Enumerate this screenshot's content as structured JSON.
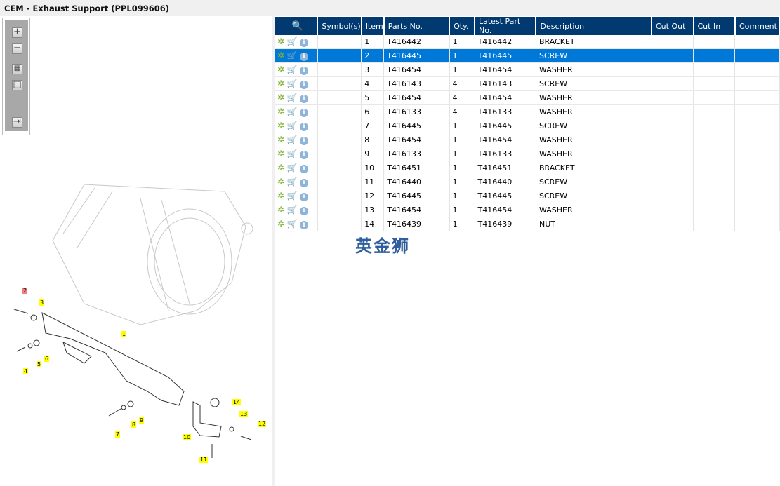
{
  "window": {
    "title": "CEM - Exhaust Support (PPL099606)"
  },
  "toolbar": {
    "zoom_in": "+",
    "zoom_out": "−",
    "fit": "▦",
    "actual": "□",
    "export": "⇥"
  },
  "table": {
    "headers": [
      "",
      "Symbol(s)",
      "Item",
      "Parts No.",
      "Qty.",
      "Latest Part No.",
      "Description",
      "Cut Out",
      "Cut In",
      "Comment"
    ],
    "selected_item": "2",
    "rows": [
      {
        "item": "1",
        "part": "T416442",
        "qty": "1",
        "latest": "T416442",
        "desc": "BRACKET"
      },
      {
        "item": "2",
        "part": "T416445",
        "qty": "1",
        "latest": "T416445",
        "desc": "SCREW"
      },
      {
        "item": "3",
        "part": "T416454",
        "qty": "1",
        "latest": "T416454",
        "desc": "WASHER"
      },
      {
        "item": "4",
        "part": "T416143",
        "qty": "4",
        "latest": "T416143",
        "desc": "SCREW"
      },
      {
        "item": "5",
        "part": "T416454",
        "qty": "4",
        "latest": "T416454",
        "desc": "WASHER"
      },
      {
        "item": "6",
        "part": "T416133",
        "qty": "4",
        "latest": "T416133",
        "desc": "WASHER"
      },
      {
        "item": "7",
        "part": "T416445",
        "qty": "1",
        "latest": "T416445",
        "desc": "SCREW"
      },
      {
        "item": "8",
        "part": "T416454",
        "qty": "1",
        "latest": "T416454",
        "desc": "WASHER"
      },
      {
        "item": "9",
        "part": "T416133",
        "qty": "1",
        "latest": "T416133",
        "desc": "WASHER"
      },
      {
        "item": "10",
        "part": "T416451",
        "qty": "1",
        "latest": "T416451",
        "desc": "BRACKET"
      },
      {
        "item": "11",
        "part": "T416440",
        "qty": "1",
        "latest": "T416440",
        "desc": "SCREW"
      },
      {
        "item": "12",
        "part": "T416445",
        "qty": "1",
        "latest": "T416445",
        "desc": "SCREW"
      },
      {
        "item": "13",
        "part": "T416454",
        "qty": "1",
        "latest": "T416454",
        "desc": "WASHER"
      },
      {
        "item": "14",
        "part": "T416439",
        "qty": "1",
        "latest": "T416439",
        "desc": "NUT"
      }
    ]
  },
  "watermark": "英金狮",
  "callouts": [
    "1",
    "2",
    "3",
    "4",
    "5",
    "6",
    "7",
    "8",
    "9",
    "10",
    "11",
    "12",
    "13",
    "14"
  ],
  "colors": {
    "header": "#003a70",
    "selected": "#0078d7",
    "callout": "#ffff00",
    "callout_selected": "#f08080"
  }
}
